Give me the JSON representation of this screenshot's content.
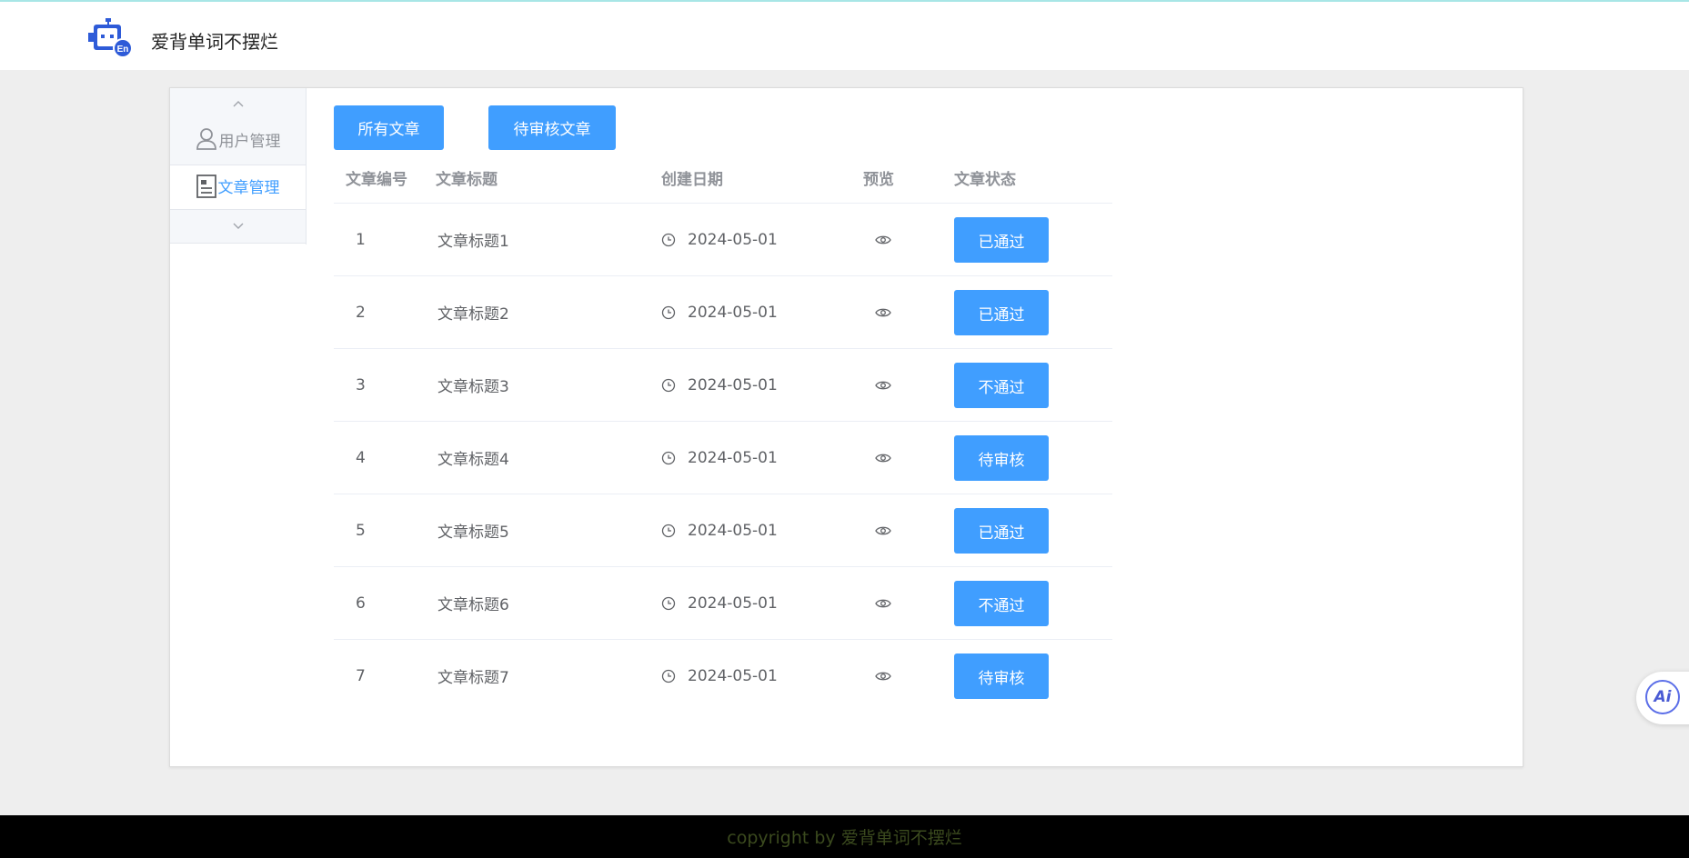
{
  "header": {
    "brand": "爱背单词不摆烂"
  },
  "sidebar": {
    "items": [
      {
        "label": "用户管理",
        "icon": "user-icon",
        "active": false
      },
      {
        "label": "文章管理",
        "icon": "document-icon",
        "active": true
      }
    ]
  },
  "tabs": {
    "all": "所有文章",
    "pending": "待审核文章"
  },
  "table": {
    "headers": {
      "id": "文章编号",
      "title": "文章标题",
      "date": "创建日期",
      "preview": "预览",
      "status": "文章状态"
    },
    "rows": [
      {
        "id": "1",
        "title": "文章标题1",
        "date": "2024-05-01",
        "status": "已通过"
      },
      {
        "id": "2",
        "title": "文章标题2",
        "date": "2024-05-01",
        "status": "已通过"
      },
      {
        "id": "3",
        "title": "文章标题3",
        "date": "2024-05-01",
        "status": "不通过"
      },
      {
        "id": "4",
        "title": "文章标题4",
        "date": "2024-05-01",
        "status": "待审核"
      },
      {
        "id": "5",
        "title": "文章标题5",
        "date": "2024-05-01",
        "status": "已通过"
      },
      {
        "id": "6",
        "title": "文章标题6",
        "date": "2024-05-01",
        "status": "不通过"
      },
      {
        "id": "7",
        "title": "文章标题7",
        "date": "2024-05-01",
        "status": "待审核"
      }
    ]
  },
  "ai_button": {
    "label": "Ai",
    "icon": "ai-assistant-icon"
  },
  "footer": {
    "text": "copyright by 爱背单词不摆烂"
  },
  "colors": {
    "primary": "#409eff",
    "footer_bg": "#000000",
    "page_bg": "#eeeeee"
  }
}
